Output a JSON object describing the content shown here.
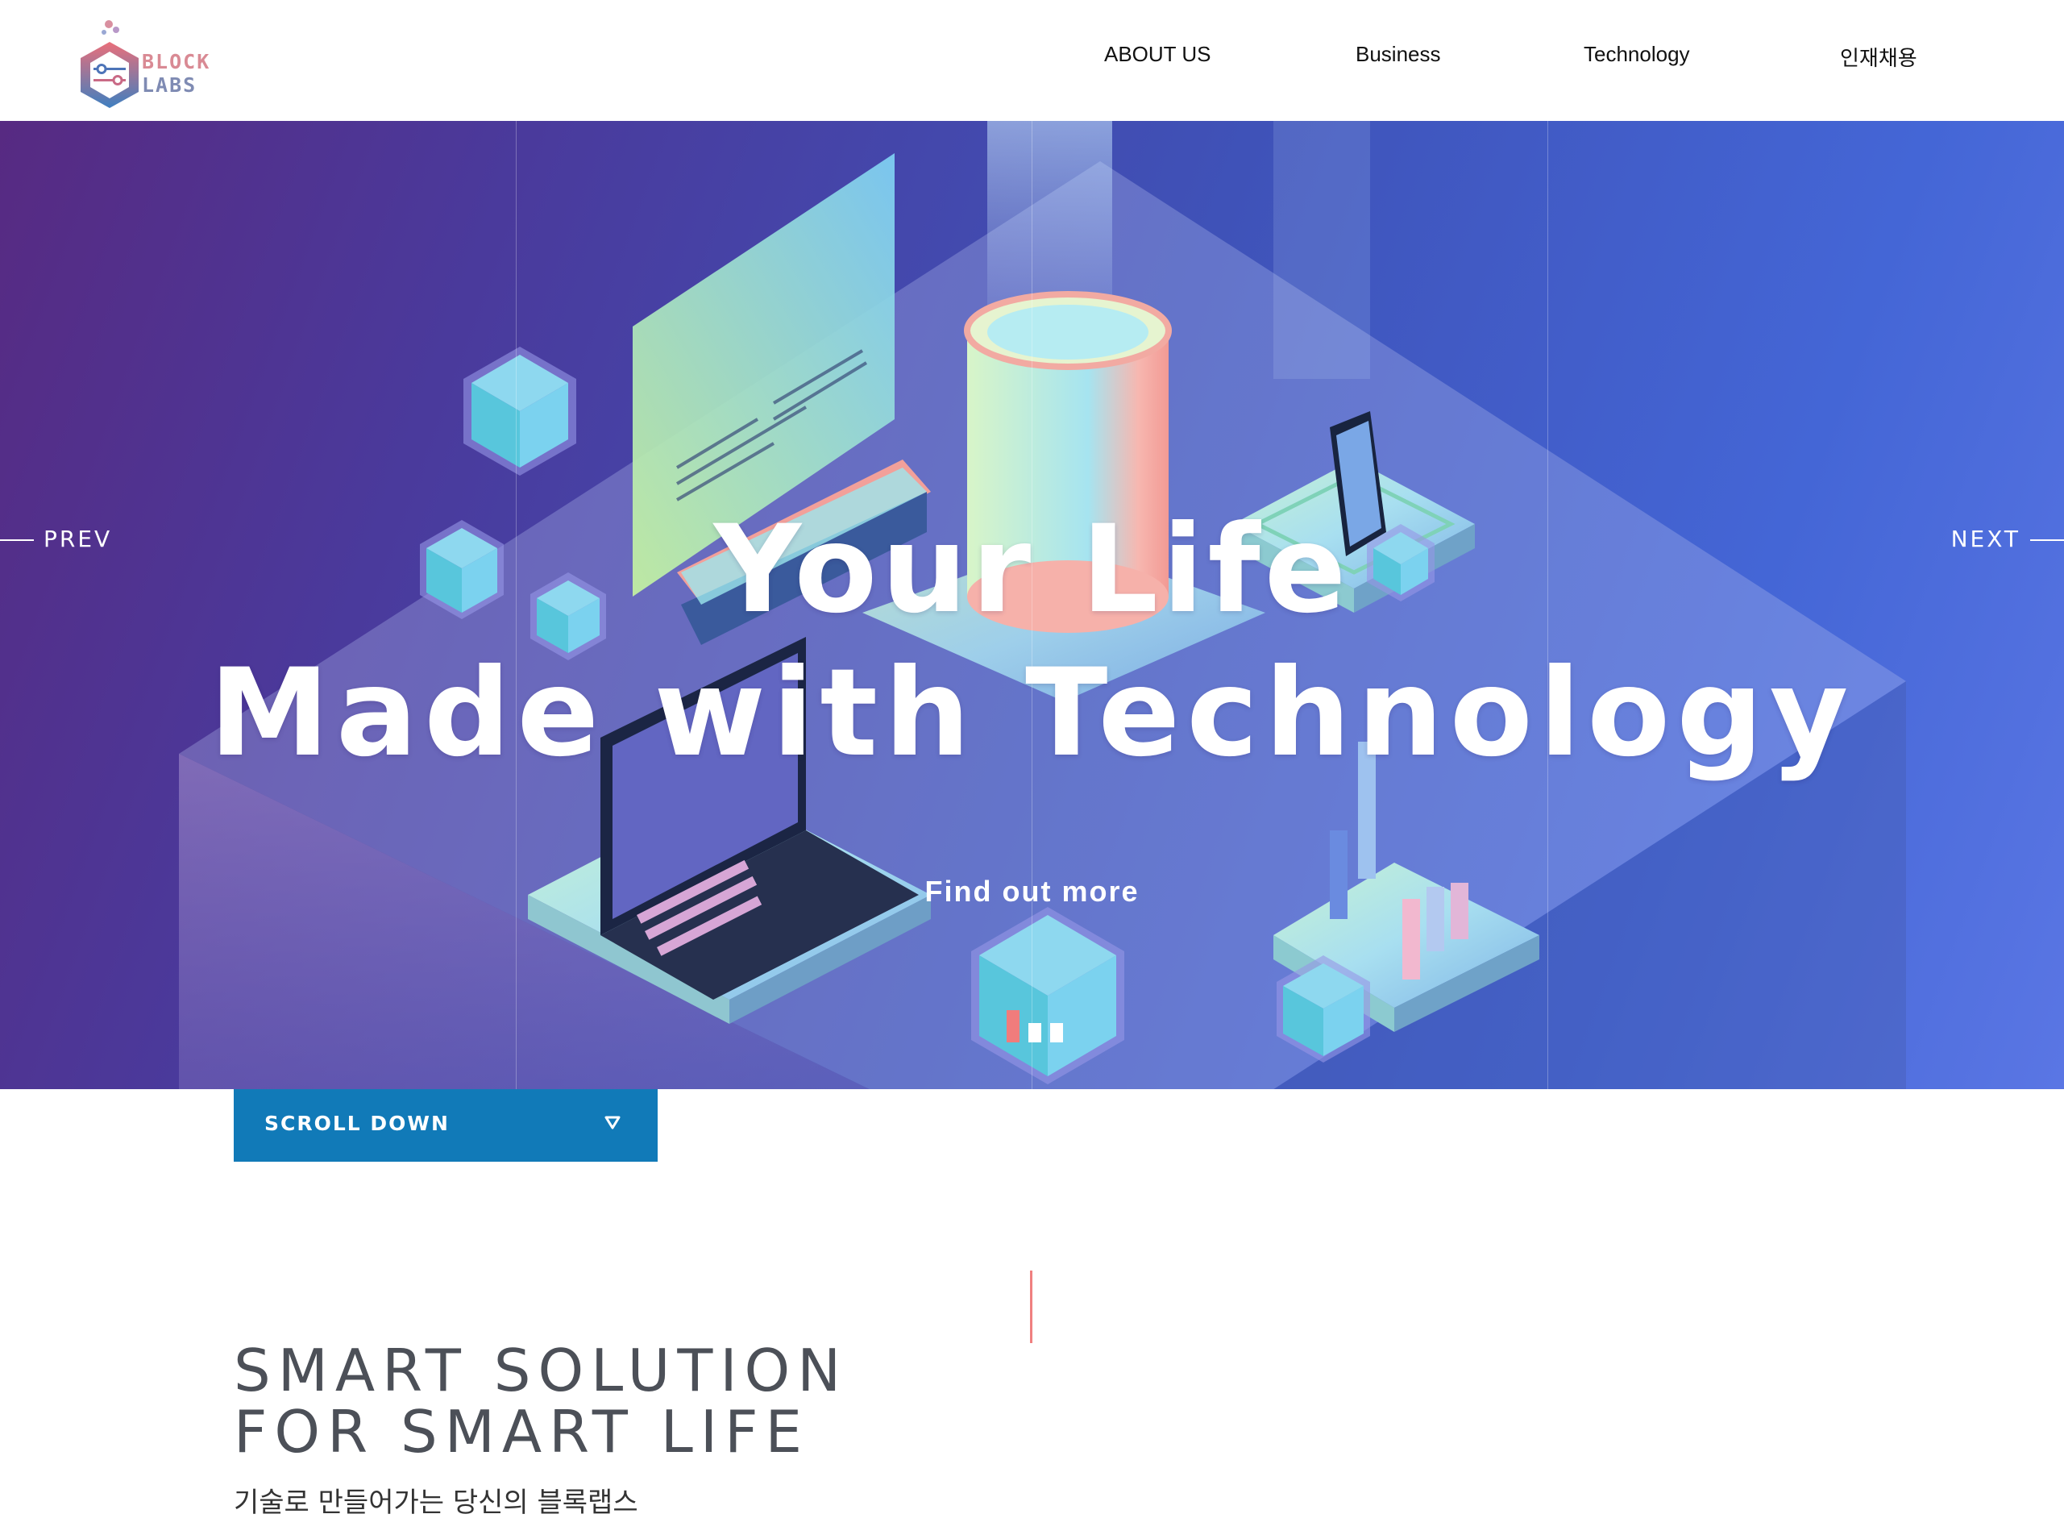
{
  "logo": {
    "line1": "BLOCK",
    "line2": "LABS"
  },
  "nav": [
    {
      "label": "ABOUT US"
    },
    {
      "label": "Business"
    },
    {
      "label": "Technology"
    },
    {
      "label": "인재채용"
    }
  ],
  "hero": {
    "title_line1": "Your Life",
    "title_line2": "Made with Technology",
    "cta": "Find out more",
    "prev": "PREV",
    "next": "NEXT",
    "slides": 3,
    "active_slide": 1
  },
  "scroll_down": {
    "label": "SCROLL DOWN"
  },
  "section": {
    "heading_line1": "SMART SOLUTION",
    "heading_line2": "FOR SMART LIFE",
    "subtitle": "기술로 만들어가는 당신의 블록랩스"
  },
  "colors": {
    "accent_blue": "#117ab8",
    "accent_red": "#f07c7c",
    "hero_start": "#572a82",
    "hero_end": "#5a76e4"
  }
}
